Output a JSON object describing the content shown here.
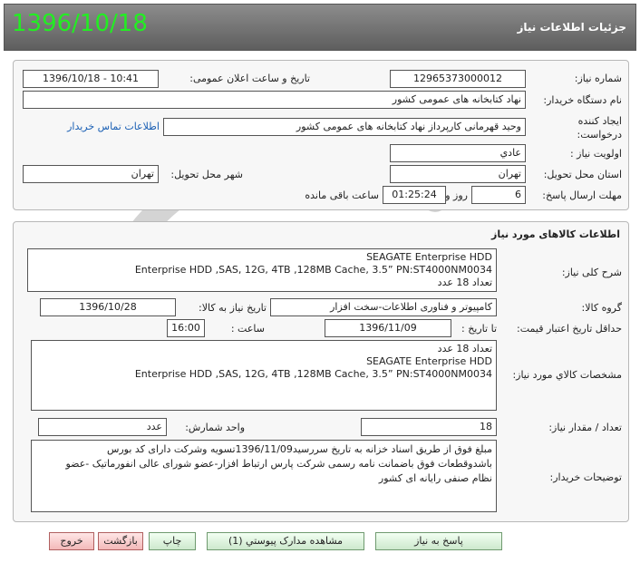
{
  "header": {
    "date": "1396/10/18",
    "title": "جزئیات اطلاعات نیاز"
  },
  "need_info": {
    "need_number_label": "شماره نیاز:",
    "need_number": "1296537300001‌2",
    "announce_label": "تاریخ و ساعت اعلان عمومی:",
    "announce_value": "1396/10/18 - 10:41",
    "buyer_org_label": "نام دستگاه خریدار:",
    "buyer_org": "نهاد کتابخانه های عمومی کشور",
    "creator_label": "ایجاد کننده درخواست:",
    "creator": "وحید  قهرمانی کارپرداز نهاد کتابخانه های عمومی کشور",
    "contact_link": "اطلاعات تماس خریدار",
    "priority_label": "اولویت نیاز :",
    "priority": "عادي",
    "province_label": "استان محل تحویل:",
    "province": "تهران",
    "city_label": "شهر محل تحویل:",
    "city": "تهران",
    "deadline_label": "مهلت ارسال پاسخ:",
    "deadline_days": "6",
    "days_word": "روز و",
    "deadline_time": "01:25:24",
    "remaining_word": "ساعت باقی مانده"
  },
  "goods": {
    "section_title": "اطلاعات کالاهای مورد نیاز",
    "general_desc_label": "شرح کلی نیاز:",
    "general_desc_lines": [
      "SEAGATE Enterprise HDD",
      "Enterprise HDD ,SAS, 12G, 4TB ,128MB Cache, 3.5” PN:ST4000NM0034",
      "تعداد 18 عدد"
    ],
    "group_label": "گروه کالا:",
    "group_value": "کامپیوتر و فناوری اطلاعات-سخت افزار",
    "need_date_label": "تاریخ نیاز به کالا:",
    "need_date": "1396/10/28",
    "price_validity_label": "حداقل تاریخ اعتبار قیمت:",
    "until_date_label": "تا تاریخ :",
    "until_date": "1396/11/09",
    "hour_label": "ساعت :",
    "hour_value": "16:00",
    "specs_label": "مشخصات کالاي مورد نیاز:",
    "specs_lines": [
      "تعداد 18 عدد",
      "SEAGATE Enterprise HDD",
      "Enterprise HDD ,SAS, 12G, 4TB ,128MB Cache, 3.5” PN:ST4000NM0034"
    ],
    "qty_label": "تعداد / مقدار نیاز:",
    "qty_value": "18",
    "unit_label": "واحد شمارش:",
    "unit_value": "عدد",
    "buyer_notes_label": "توضیحات خریدار:",
    "buyer_notes_lines": [
      "مبلغ فوق از طریق اسناد خزانه به تاریخ سررسید1396/11/09تسویه وشرکت دارای کد بورس",
      "باشدوقطعات فوق باضمانت نامه رسمی شرکت پارس ارتباط افزار-عضو شورای عالی انفورماتیک -عضو",
      "نظام صنفی رایانه ای کشور"
    ]
  },
  "footer": {
    "reply": "پاسخ به نیاز",
    "attachments": "مشاهده مدارک پیوستي (1)",
    "print": "چاپ",
    "back": "بازگشت",
    "exit": "خروج"
  },
  "colors": {
    "header_date": "#22ee22",
    "link": "#1a5fb4",
    "exit_button": "#f3b9b9"
  }
}
